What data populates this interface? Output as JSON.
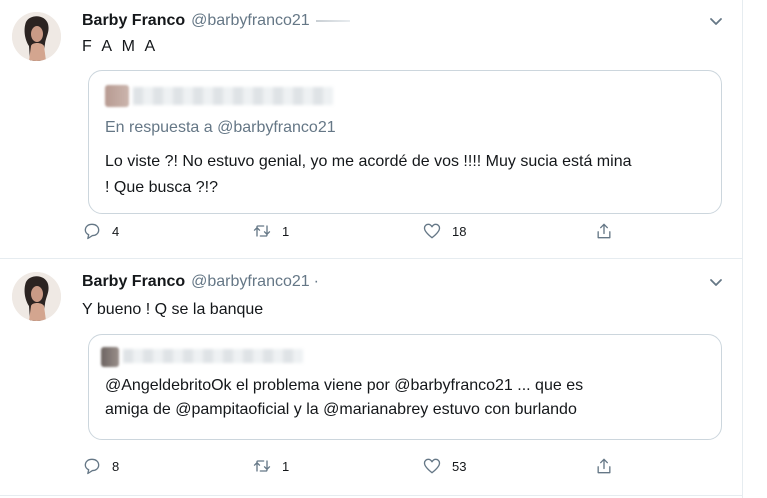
{
  "tweets": [
    {
      "author_name": "Barby Franco",
      "author_handle": "@barbyfranco21",
      "text": "F A M A",
      "quote": {
        "reply_prefix": "En respuesta a",
        "reply_handle": "@barbyfranco21",
        "text_lines": [
          "Lo viste ?! No estuvo genial, yo me acordé de vos !!!! Muy sucia está mina",
          "! Que busca ?!?"
        ]
      },
      "actions": {
        "replies": "4",
        "retweets": "1",
        "likes": "18"
      }
    },
    {
      "author_name": "Barby Franco",
      "author_handle": "@barbyfranco21",
      "separator": "·",
      "text": "Y bueno ! Q se la banque",
      "quote": {
        "text_lines": [
          "@AngeldebritoOk el problema viene por @barbyfranco21 ... que es",
          "amiga de @pampitaoficial y la @marianabrey estuvo con burlando"
        ]
      },
      "actions": {
        "replies": "8",
        "retweets": "1",
        "likes": "53"
      }
    }
  ],
  "icons": {
    "reply": "speech-bubble-icon",
    "retweet": "retweet-arrows-icon",
    "like": "heart-outline-icon",
    "share": "share-upload-icon",
    "caret": "chevron-down-icon"
  },
  "colors": {
    "secondary_text": "#657786",
    "border": "#ccd6dd",
    "divider": "#e6ecf0"
  }
}
